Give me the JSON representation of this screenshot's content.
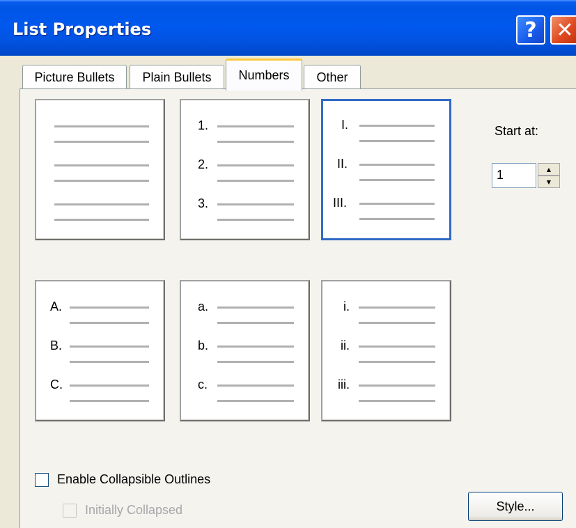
{
  "window": {
    "title": "List Properties",
    "help_label": "?",
    "close_label": "✕"
  },
  "tabs": [
    {
      "label": "Picture Bullets",
      "active": false
    },
    {
      "label": "Plain Bullets",
      "active": false
    },
    {
      "label": "Numbers",
      "active": true
    },
    {
      "label": "Other",
      "active": false
    }
  ],
  "styles": [
    {
      "name": "none",
      "markers": [
        "",
        "",
        ""
      ],
      "selected": false
    },
    {
      "name": "arabic",
      "markers": [
        "1.",
        "2.",
        "3."
      ],
      "selected": false
    },
    {
      "name": "upper-roman",
      "markers": [
        "I.",
        "II.",
        "III."
      ],
      "selected": true
    },
    {
      "name": "upper-alpha",
      "markers": [
        "A.",
        "B.",
        "C."
      ],
      "selected": false
    },
    {
      "name": "lower-alpha",
      "markers": [
        "a.",
        "b.",
        "c."
      ],
      "selected": false
    },
    {
      "name": "lower-roman",
      "markers": [
        "i.",
        "ii.",
        "iii."
      ],
      "selected": false
    }
  ],
  "start_at": {
    "label": "Start at:",
    "value": "1"
  },
  "options": {
    "enable_collapsible": {
      "label": "Enable Collapsible Outlines",
      "checked": false,
      "enabled": true
    },
    "initially_collapsed": {
      "label": "Initially Collapsed",
      "checked": false,
      "enabled": false
    }
  },
  "buttons": {
    "style_label": "Style..."
  },
  "colors": {
    "title_bar": "#0055e5",
    "selection_border": "#316ac5",
    "dialog_bg": "#ece9d8",
    "panel_bg": "#f4f3ee"
  }
}
